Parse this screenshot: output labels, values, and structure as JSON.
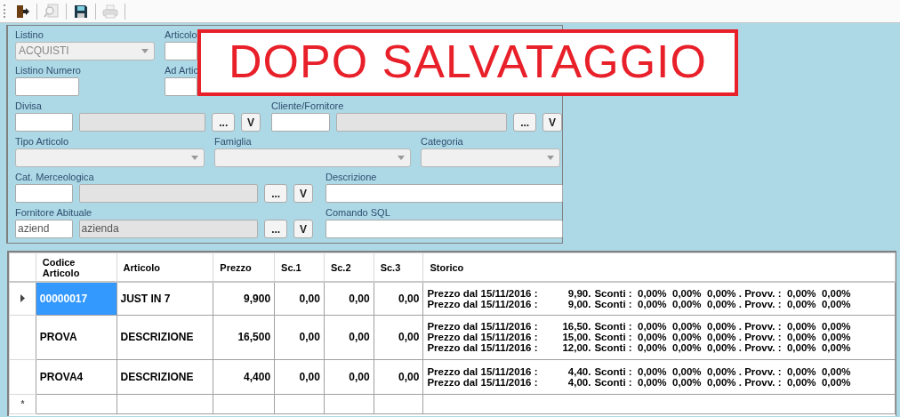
{
  "toolbar": [
    {
      "kind": "exit",
      "disabled": false
    },
    {
      "kind": "search",
      "disabled": true
    },
    {
      "kind": "save",
      "disabled": false
    },
    {
      "kind": "print",
      "disabled": true
    }
  ],
  "filters": [
    [
      {
        "kind": "combo",
        "label": "Listino",
        "value": "ACQUISTI"
      },
      {
        "kind": "text",
        "label": "Articolo"
      }
    ],
    [
      {
        "kind": "text",
        "label": "Listino Numero"
      },
      {
        "kind": "text",
        "label": "Ad Artic"
      }
    ],
    [
      {
        "kind": "lookup",
        "label": "Divisa",
        "browse": "...",
        "validate": "V"
      },
      {
        "kind": "lookup",
        "label": "Cliente/Fornitore",
        "browse": "...",
        "validate": "V"
      }
    ],
    [
      {
        "kind": "combo",
        "label": "Tipo Articolo"
      },
      {
        "kind": "combo",
        "label": "Famiglia"
      },
      {
        "kind": "combo",
        "label": "Categoria"
      }
    ],
    [
      {
        "kind": "lookup",
        "label": "Cat. Merceologica",
        "browse": "...",
        "validate": "V"
      },
      {
        "kind": "text",
        "label": "Descrizione"
      }
    ],
    [
      {
        "kind": "lookup",
        "label": "Fornitore Abituale",
        "value": "aziend",
        "description": "azienda",
        "browse": "...",
        "validate": "V"
      },
      {
        "kind": "text",
        "label": "Comando SQL"
      }
    ]
  ],
  "overlay_label": "DOPO SALVATAGGIO",
  "grid": {
    "columns": [
      "Codice Articolo",
      "Articolo",
      "Prezzo",
      "Sc.1",
      "Sc.2",
      "Sc.3",
      "Storico"
    ],
    "rows": [
      {
        "selected": true,
        "cells": [
          "00000017",
          "JUST IN 7",
          "9,900",
          "0,00",
          "0,00",
          "0,00"
        ],
        "storico": [
          {
            "label": "Prezzo dal 15/11/2016 :",
            "price": "9,90.",
            "rest": "Sconti :  0,00%  0,00%  0,00% . Provv. :  0,00%  0,00%"
          },
          {
            "label": "Prezzo dal 15/11/2016 :",
            "price": "9,00.",
            "rest": "Sconti :  0,00%  0,00%  0,00% . Provv. :  0,00%  0,00%"
          }
        ]
      },
      {
        "selected": false,
        "cells": [
          "PROVA",
          "DESCRIZIONE",
          "16,500",
          "0,00",
          "0,00",
          "0,00"
        ],
        "storico": [
          {
            "label": "Prezzo dal 15/11/2016 :",
            "price": "16,50.",
            "rest": "Sconti :  0,00%  0,00%  0,00% . Provv. :  0,00%  0,00%"
          },
          {
            "label": "Prezzo dal 15/11/2016 :",
            "price": "15,00.",
            "rest": "Sconti :  0,00%  0,00%  0,00% . Provv. :  0,00%  0,00%"
          },
          {
            "label": "Prezzo dal 15/11/2016 :",
            "price": "12,00.",
            "rest": "Sconti :  0,00%  0,00%  0,00% . Provv. :  0,00%  0,00%"
          }
        ]
      },
      {
        "selected": false,
        "cells": [
          "PROVA4",
          "DESCRIZIONE",
          "4,400",
          "0,00",
          "0,00",
          "0,00"
        ],
        "storico": [
          {
            "label": "Prezzo dal 15/11/2016 :",
            "price": "4,40.",
            "rest": "Sconti :  0,00%  0,00%  0,00% . Provv. :  0,00%  0,00%"
          },
          {
            "label": "Prezzo dal 15/11/2016 :",
            "price": "4,00.",
            "rest": "Sconti :  0,00%  0,00%  0,00% . Provv. :  0,00%  0,00%"
          }
        ]
      }
    ],
    "new_row_marker": "*"
  }
}
